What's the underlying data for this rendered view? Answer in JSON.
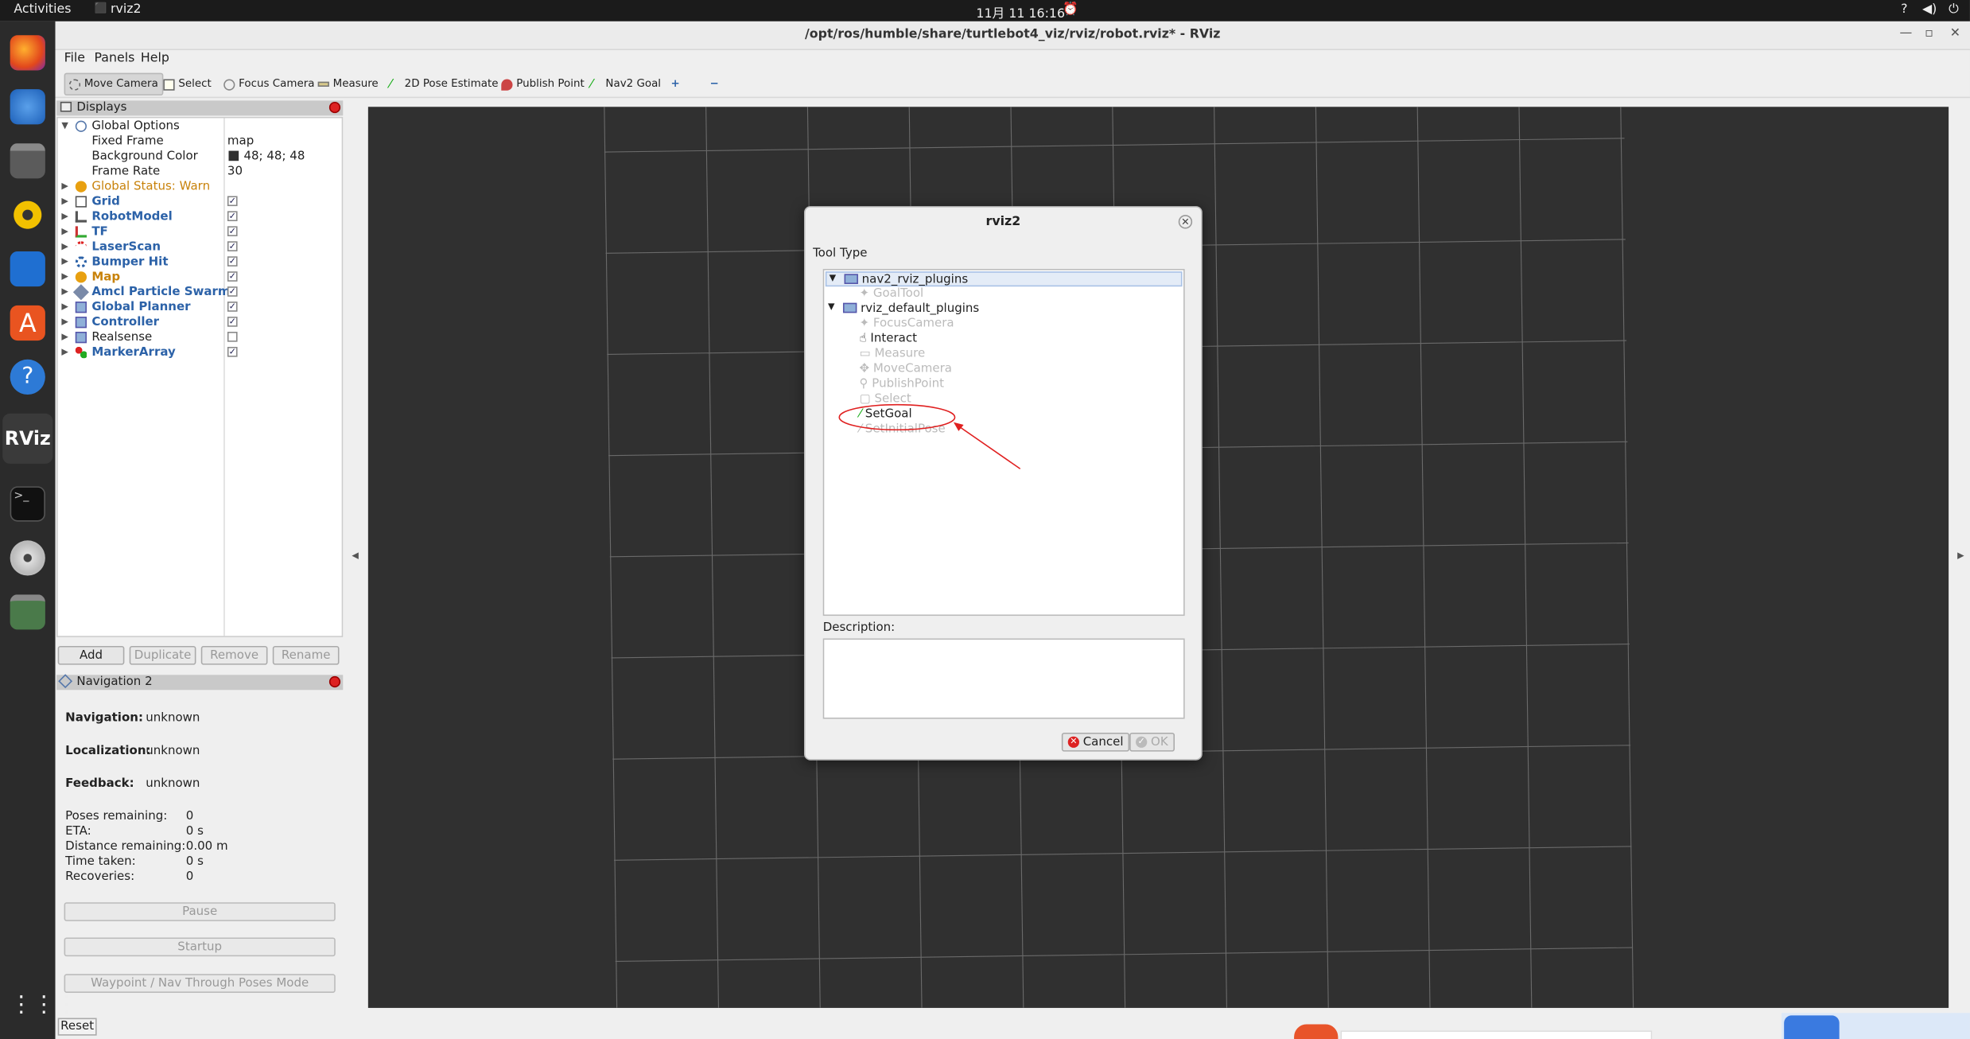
{
  "topbar": {
    "activities": "Activities",
    "app": "rviz2",
    "clock": "11月 11  16:16"
  },
  "window": {
    "title": "/opt/ros/humble/share/turtlebot4_viz/rviz/robot.rviz* - RViz"
  },
  "menu": {
    "file": "File",
    "panels": "Panels",
    "help": "Help"
  },
  "toolbar": {
    "tools": [
      "Move Camera",
      "Select",
      "Focus Camera",
      "Measure",
      "2D Pose Estimate",
      "Publish Point",
      "Nav2 Goal"
    ]
  },
  "displays": {
    "title": "Displays",
    "global_options": "Global Options",
    "fixed_frame_label": "Fixed Frame",
    "fixed_frame": "map",
    "bg_label": "Background Color",
    "bg_value": "48; 48; 48",
    "frame_rate_label": "Frame Rate",
    "frame_rate": "30",
    "global_status": "Global Status: Warn",
    "items": [
      {
        "name": "Grid",
        "checked": "✓"
      },
      {
        "name": "RobotModel",
        "checked": "✓"
      },
      {
        "name": "TF",
        "checked": "✓"
      },
      {
        "name": "LaserScan",
        "checked": "✓"
      },
      {
        "name": "Bumper Hit",
        "checked": "✓"
      },
      {
        "name": "Map",
        "checked": "✓"
      },
      {
        "name": "Amcl Particle Swarm",
        "checked": "✓"
      },
      {
        "name": "Global Planner",
        "checked": "✓"
      },
      {
        "name": "Controller",
        "checked": "✓"
      },
      {
        "name": "Realsense",
        "checked": ""
      },
      {
        "name": "MarkerArray",
        "checked": "✓"
      }
    ],
    "buttons": {
      "add": "Add",
      "duplicate": "Duplicate",
      "remove": "Remove",
      "rename": "Rename"
    }
  },
  "nav2": {
    "title": "Navigation 2",
    "navigation_label": "Navigation:",
    "navigation": "unknown",
    "localization_label": "Localization:",
    "localization": "unknown",
    "feedback_label": "Feedback:",
    "feedback": "unknown",
    "poses_label": "Poses remaining:",
    "poses": "0",
    "eta_label": "ETA:",
    "eta": "0 s",
    "distance_label": "Distance remaining:",
    "distance": "0.00 m",
    "time_label": "Time taken:",
    "time": "0 s",
    "recoveries_label": "Recoveries:",
    "recoveries": "0",
    "pause": "Pause",
    "startup": "Startup",
    "waypoint": "Waypoint / Nav Through Poses Mode"
  },
  "reset": "Reset",
  "dialog": {
    "title": "rviz2",
    "tool_type": "Tool Type",
    "groups": [
      {
        "name": "nav2_rviz_plugins",
        "tools": [
          "GoalTool"
        ]
      },
      {
        "name": "rviz_default_plugins",
        "tools": [
          "FocusCamera",
          "Interact",
          "Measure",
          "MoveCamera",
          "PublishPoint",
          "Select",
          "SetGoal",
          "SetInitialPose"
        ]
      }
    ],
    "description": "Description:",
    "cancel": "Cancel",
    "ok": "OK"
  },
  "colors": {
    "viewport_bg": "#303030",
    "grid": "#6a6a6a",
    "annotation": "#e02020",
    "link_blue": "#2c62a8",
    "warn": "#c8820a"
  }
}
